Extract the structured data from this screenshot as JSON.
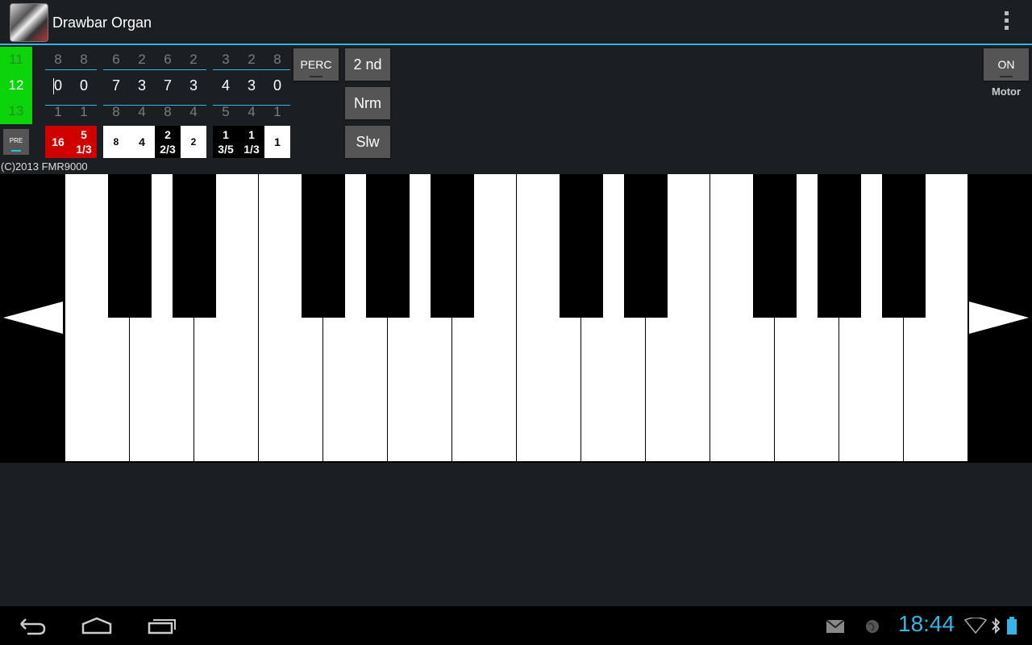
{
  "app": {
    "title": "Drawbar Organ",
    "icon": "drawbar-organ-app-icon"
  },
  "presets": [
    "11",
    "12",
    "13"
  ],
  "drawbars": {
    "top": [
      "8",
      "8",
      "6",
      "2",
      "6",
      "2",
      "3",
      "2",
      "8"
    ],
    "values": [
      "0",
      "0",
      "7",
      "3",
      "7",
      "3",
      "4",
      "3",
      "0"
    ],
    "bottom": [
      "1",
      "1",
      "8",
      "4",
      "8",
      "4",
      "5",
      "4",
      "1"
    ]
  },
  "footages": [
    {
      "line1": "16",
      "line2": ""
    },
    {
      "line1": "5",
      "line2": "1/3"
    },
    {
      "line1": "8",
      "line2": ""
    },
    {
      "line1": "4",
      "line2": ""
    },
    {
      "line1": "2",
      "line2": "2/3"
    },
    {
      "line1": "2",
      "line2": ""
    },
    {
      "line1": "1",
      "line2": "3/5"
    },
    {
      "line1": "1",
      "line2": "1/3"
    },
    {
      "line1": "1",
      "line2": ""
    }
  ],
  "buttons": {
    "pre": "PRE",
    "perc": "PERC",
    "second": "2 nd",
    "normal": "Nrm",
    "slow": "Slw",
    "motor_toggle": "ON",
    "motor_label": "Motor"
  },
  "copyright": "(C)2013 FMR9000",
  "status": {
    "time": "18:44"
  },
  "colors": {
    "accent": "#33b5e5",
    "preset_green": "#0bd40b",
    "footage_red": "#d00000"
  }
}
